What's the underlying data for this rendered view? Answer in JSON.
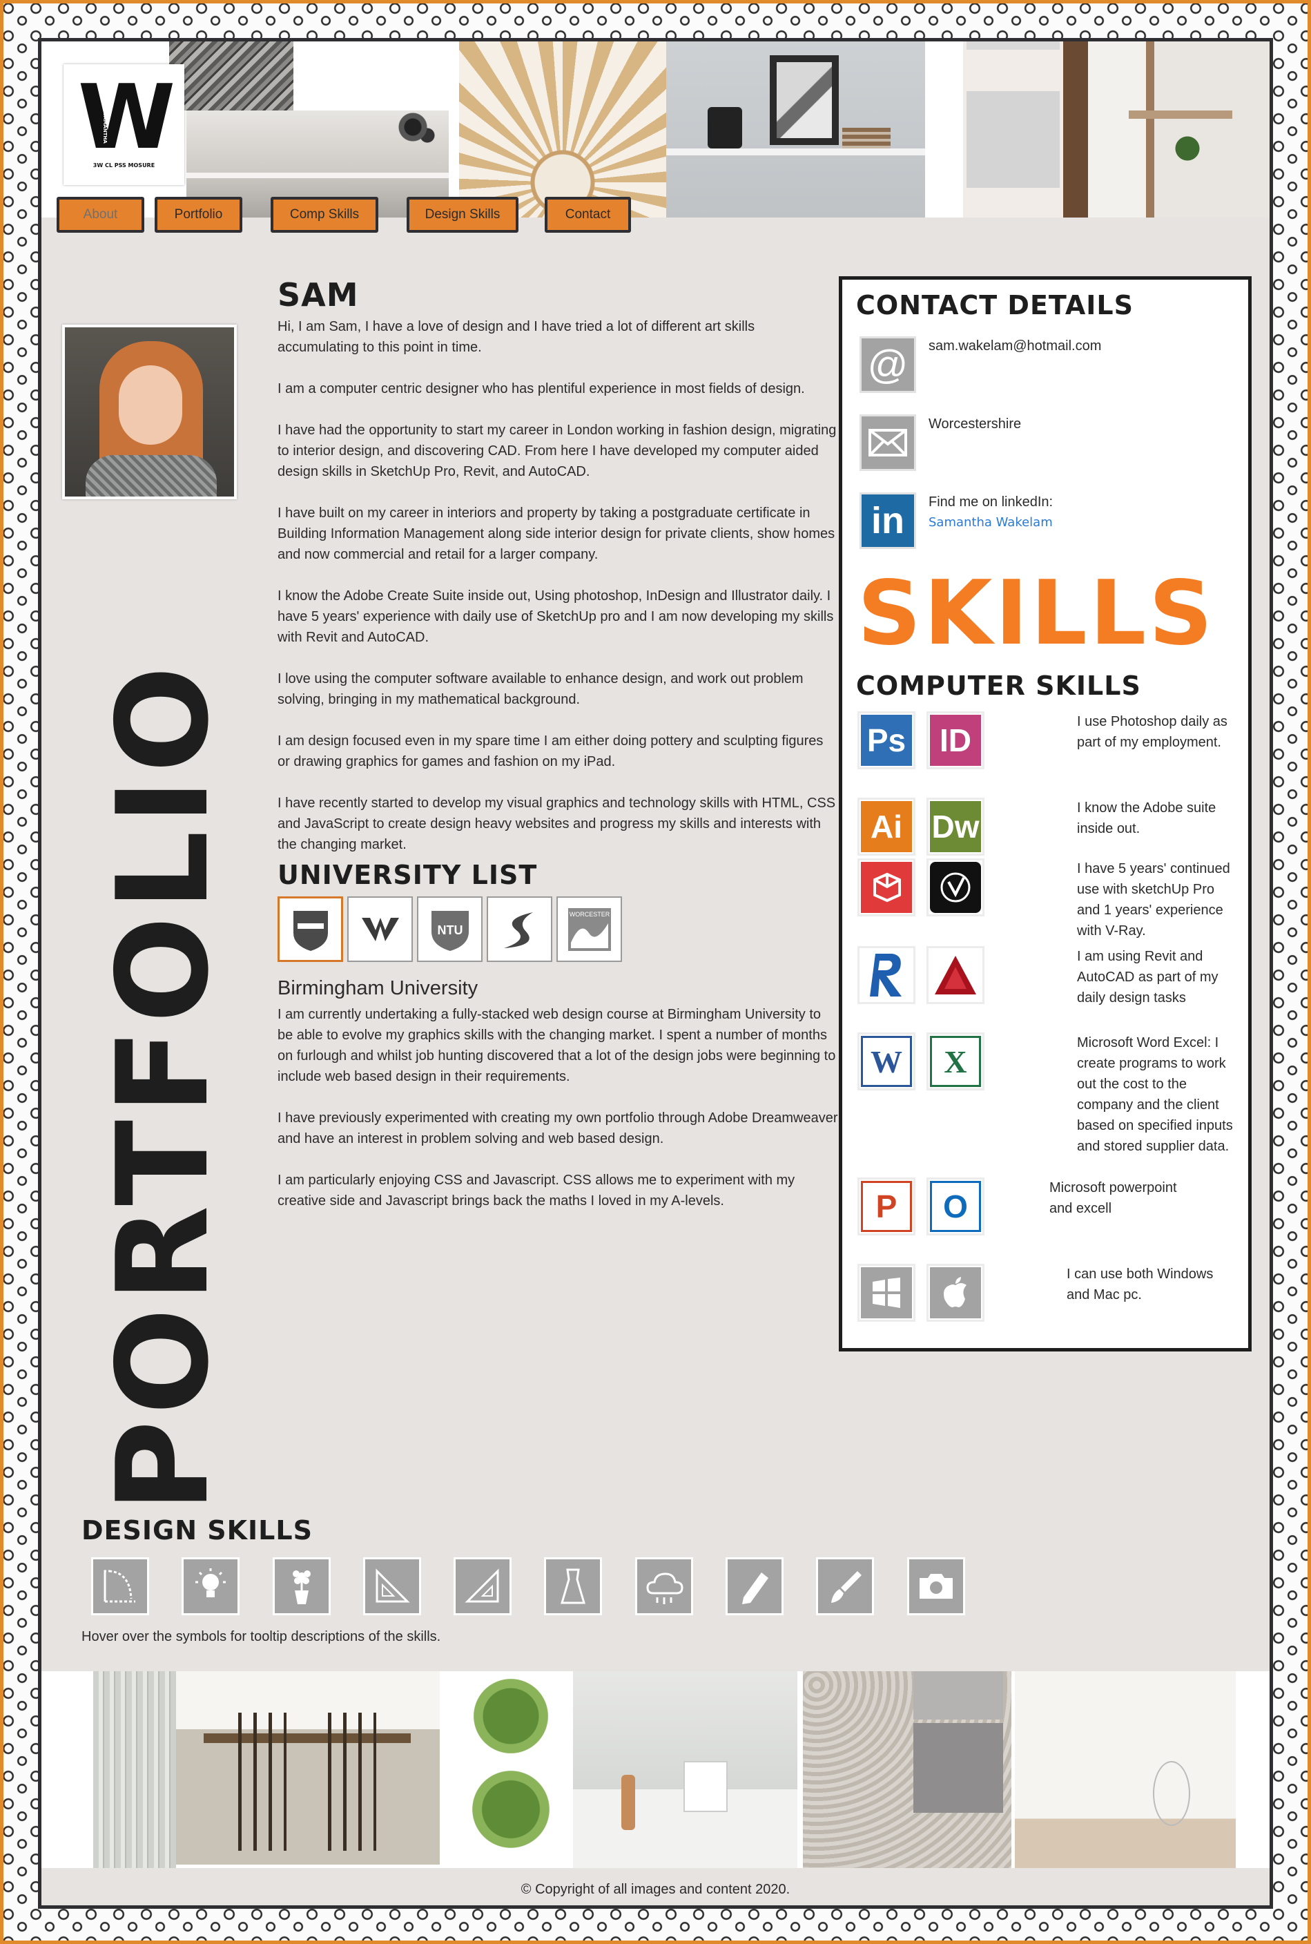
{
  "logo": {
    "letter": "W",
    "subtitle": "3W CL PSS MOSURE",
    "side": "SAMANTHA"
  },
  "nav": [
    "About",
    "Portfolio",
    "Comp Skills",
    "Design Skills",
    "Contact"
  ],
  "portfolio_vertical": "PORTFOLIO",
  "about": {
    "title": "SAM",
    "paragraphs": [
      "Hi, I am Sam, I have a love of design and I have tried a lot of different art skills accumulating to this point in time.",
      "I am a computer centric designer who has plentiful experience in most fields of design.",
      "I have had the opportunity to start my career in London working in fashion design, migrating to interior design, and discovering CAD. From here I have developed my computer aided design skills in SketchUp Pro, Revit, and AutoCAD.",
      "I have built on my career in interiors and property by taking a postgraduate certificate in Building Information Management along side interior design for private clients, show homes and now commercial and retail for a larger company.",
      "I know the Adobe Create Suite inside out, Using photoshop, InDesign and Illustrator daily. I have 5 years' experience with daily use of SketchUp pro and I am now developing my skills with Revit and AutoCAD.",
      "I love using the computer software available to enhance design, and work out problem solving, bringing in my mathematical background.",
      "I am design focused even in my spare time I am either doing pottery and sculpting figures or drawing graphics for games and fashion on my iPad.",
      "I have recently started to develop my visual graphics and technology skills with HTML, CSS and JavaScript to create design heavy websites and progress my skills and interests with the changing market."
    ]
  },
  "university": {
    "title": "UNIVERSITY LIST",
    "logos": [
      "",
      "",
      "NTU",
      "",
      "WORCESTER"
    ],
    "selected_name": "Birmingham University",
    "paragraphs": [
      "I am currently undertaking a fully-stacked web design course at Birmingham University to be able to evolve my graphics skills with the changing market. I spent a number of months on furlough and whilst job hunting discovered that a lot of the design jobs were beginning to include web based design in their requirements.",
      "I have previously experimented with creating my own portfolio through Adobe Dreamweaver and have an interest in problem solving and web based design.",
      "I am particularly enjoying CSS and Javascript. CSS allows me to experiment with my creative side and Javascript brings back the maths I loved in my A-levels."
    ]
  },
  "contact": {
    "title": "CONTACT DETAILS",
    "email": "sam.wakelam@hotmail.com",
    "location": "Worcestershire",
    "linkedin_label": "Find me on linkedIn:",
    "linkedin_name": "Samantha Wakelam",
    "icons": [
      "@",
      "in"
    ]
  },
  "skills": {
    "big_title": "SKILLS",
    "computer_title": "COMPUTER SKILLS",
    "icon_labels": [
      "Ps",
      "ID",
      "Ai",
      "Dw",
      "W",
      "X",
      "P",
      "O"
    ],
    "texts": [
      "I use Photoshop daily as part of my employment.",
      "I know the Adobe suite inside out.",
      "I have 5 years' continued use with sketchUp Pro and 1 years' experience with V-Ray.",
      "I am using Revit and AutoCAD as part of my daily design tasks",
      "Microsoft Word Excel: I create programs to work out the cost to the company and the client based on specified inputs and stored supplier data.",
      "Microsoft powerpoint and excell",
      "I can use both Windows and Mac pc."
    ],
    "colors": {
      "ps": "#2f6fb5",
      "id": "#c0407c",
      "ai": "#e57d1c",
      "dw": "#6d8a34",
      "word": "#2b579a",
      "excel": "#217346",
      "ppt": "#d04423",
      "outlook": "#0f6cbd",
      "orange": "#f47c23"
    }
  },
  "design_skills": {
    "title": "DESIGN SKILLS",
    "hint": "Hover over the symbols for tooltip descriptions of the skills."
  },
  "footer": "© Copyright of all images and content 2020."
}
